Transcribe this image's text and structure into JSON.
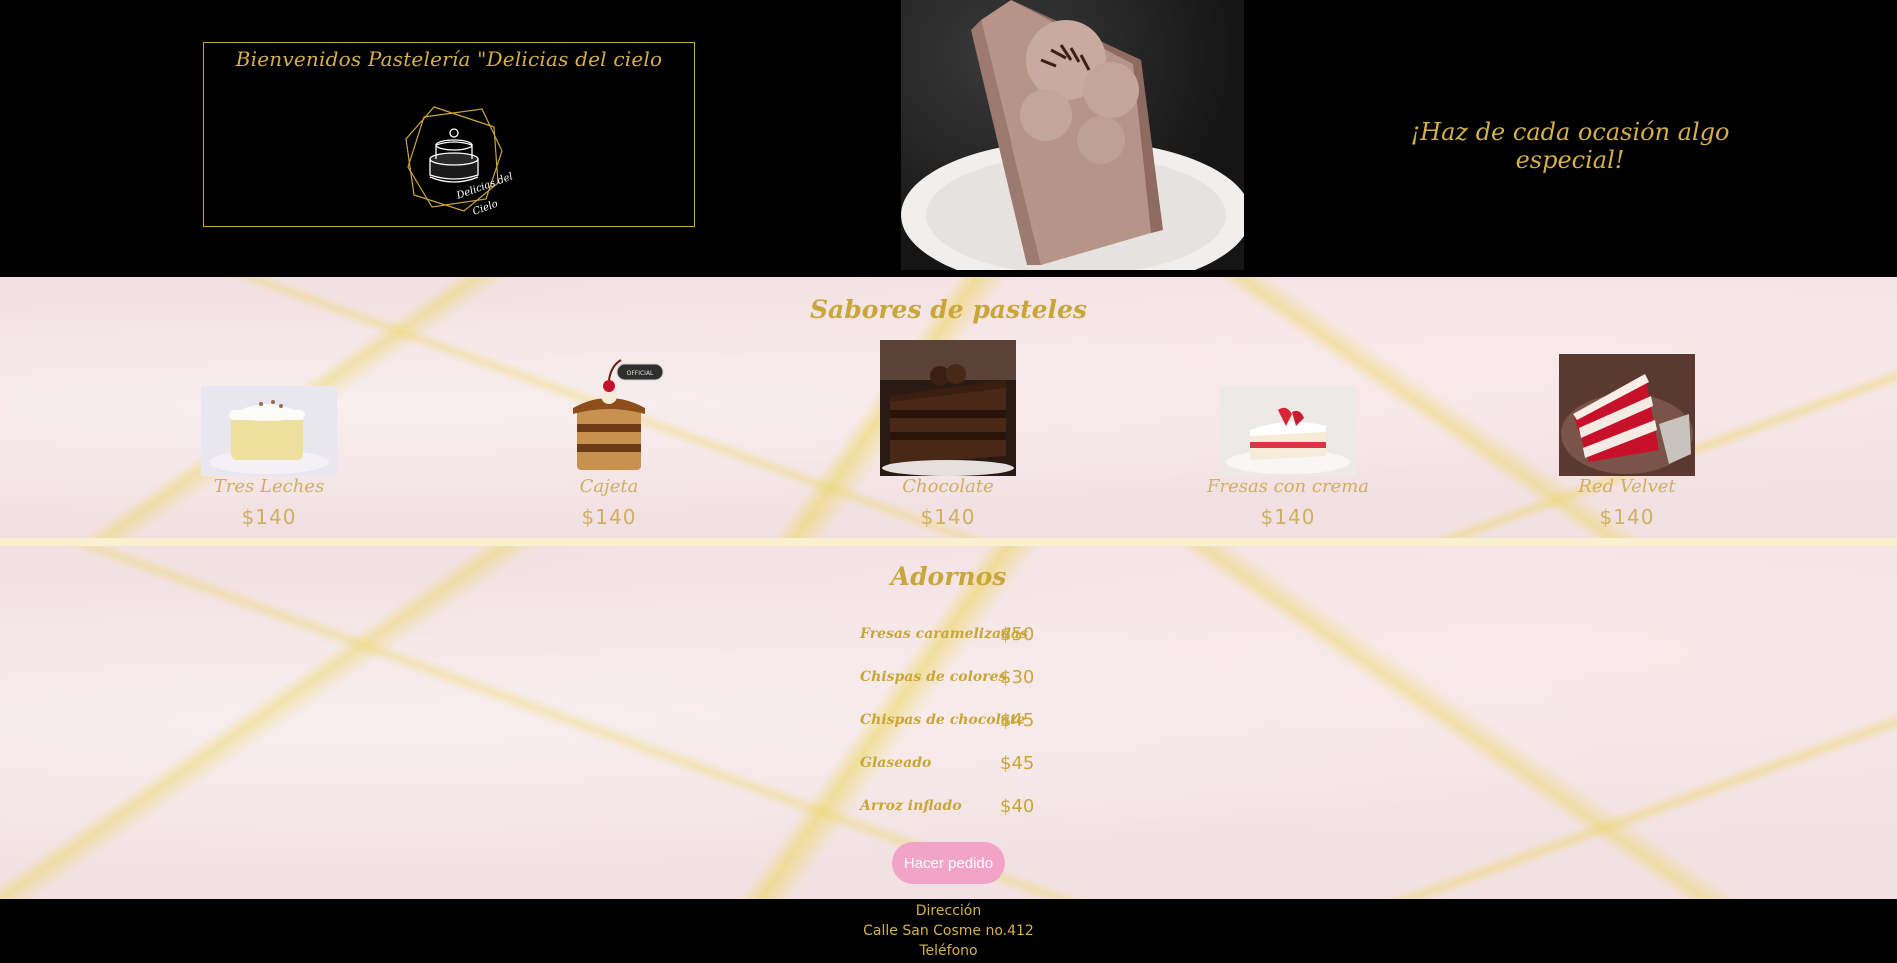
{
  "header": {
    "welcome_title": "Bienvenidos Pastelería \"Delicias del cielo",
    "logo_text_line1": "Delicias del",
    "logo_text_line2": "Cielo",
    "slogan": "¡Haz de cada ocasión algo especial!"
  },
  "flavors": {
    "title": "Sabores de pasteles",
    "items": [
      {
        "name": "Tres Leches",
        "price": "$140"
      },
      {
        "name": "Cajeta",
        "price": "$140",
        "badge": "OFFICIAL"
      },
      {
        "name": "Chocolate",
        "price": "$140"
      },
      {
        "name": "Fresas con crema",
        "price": "$140"
      },
      {
        "name": "Red Velvet",
        "price": "$140"
      }
    ]
  },
  "toppings": {
    "title": "Adornos",
    "items": [
      {
        "name": "Fresas caramelizadas",
        "price": "$50"
      },
      {
        "name": "Chispas de colores",
        "price": "$30"
      },
      {
        "name": "Chispas de chocolate",
        "price": "$45"
      },
      {
        "name": "Glaseado",
        "price": "$45"
      },
      {
        "name": "Arroz inflado",
        "price": "$40"
      }
    ],
    "order_button": "Hacer pedido"
  },
  "footer": {
    "address_label": "Dirección",
    "address_value": "Calle San Cosme no.412",
    "phone_label": "Teléfono"
  },
  "colors": {
    "gold": "#c9a63a",
    "header_bg": "#000000",
    "marble_bg": "#f2e1e3",
    "button_bg": "#f1a4c8"
  }
}
